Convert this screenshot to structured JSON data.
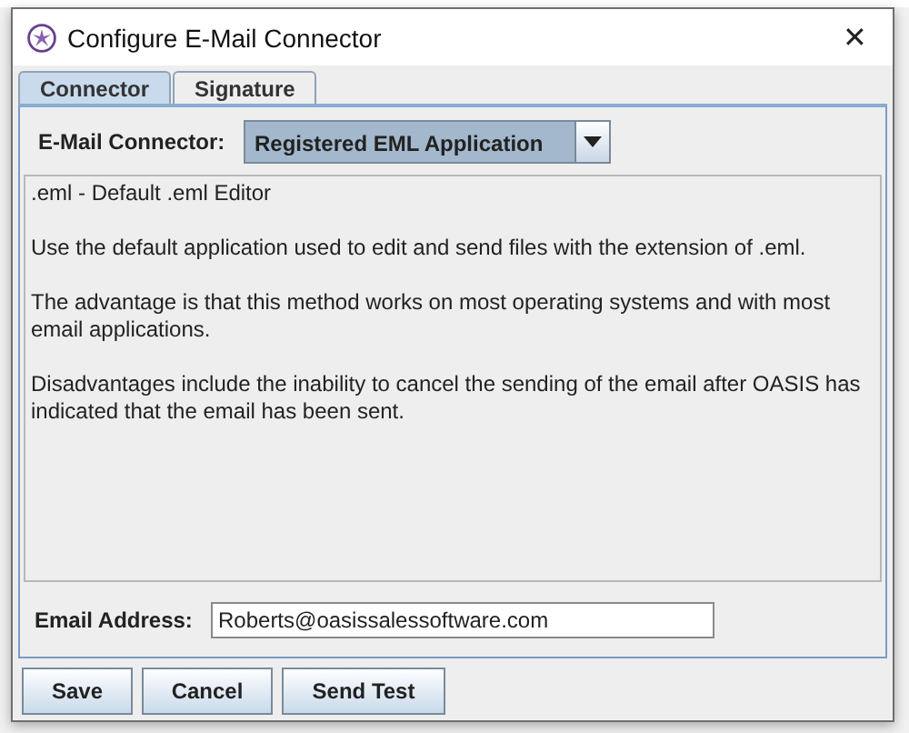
{
  "window": {
    "title": "Configure E-Mail Connector",
    "close": "✕"
  },
  "tabs": [
    {
      "label": "Connector",
      "selected": true
    },
    {
      "label": "Signature",
      "selected": false
    }
  ],
  "connector": {
    "label": "E-Mail Connector:",
    "value": "Registered EML Application"
  },
  "description": [
    ".eml - Default .eml Editor",
    "Use the default application used to edit and send files with the extension of .eml.",
    "The advantage is that this method works on most operating systems and with most email applications.",
    "Disadvantages include the inability to cancel the sending of the email after OASIS has indicated that the email has been sent."
  ],
  "email": {
    "label": "Email Address:",
    "value": "Roberts@oasissalessoftware.com"
  },
  "buttons": [
    "Save",
    "Cancel",
    "Send Test"
  ]
}
